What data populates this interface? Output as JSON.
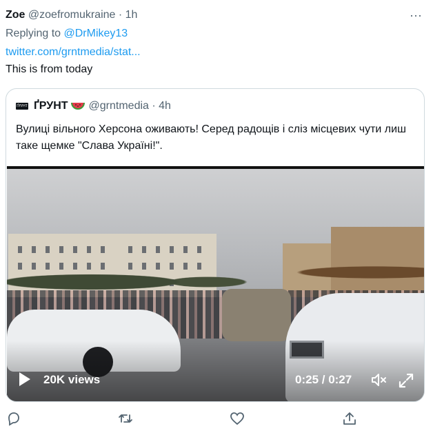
{
  "tweet": {
    "name": "Zoe",
    "handle": "@zoefromukraine",
    "dot": "·",
    "time": "1h",
    "more": "···",
    "replying_prefix": "Replying to ",
    "replying_mention": "@DrMikey13",
    "link": "twitter.com/grntmedia/stat...",
    "text": "This is from today"
  },
  "quoted": {
    "logo_text": "ҐРУНТ",
    "name": "ҐРУНТ",
    "emoji": "watermelon-emoji",
    "handle": "@grntmedia",
    "dot": "·",
    "time": "4h",
    "text": "Вулиці вільного Херсона оживають! Серед радощів і сліз місцевих чути лиш таке щемке \"Слава Україні!\"."
  },
  "video": {
    "views": "20K views",
    "timer": "0:25 / 0:27",
    "progress": 0.93
  },
  "actions": [
    "reply-icon",
    "retweet-icon",
    "like-icon",
    "share-icon"
  ],
  "colors": {
    "link": "#1d9bf0",
    "secondary": "#536471",
    "border": "#cfd9de"
  }
}
